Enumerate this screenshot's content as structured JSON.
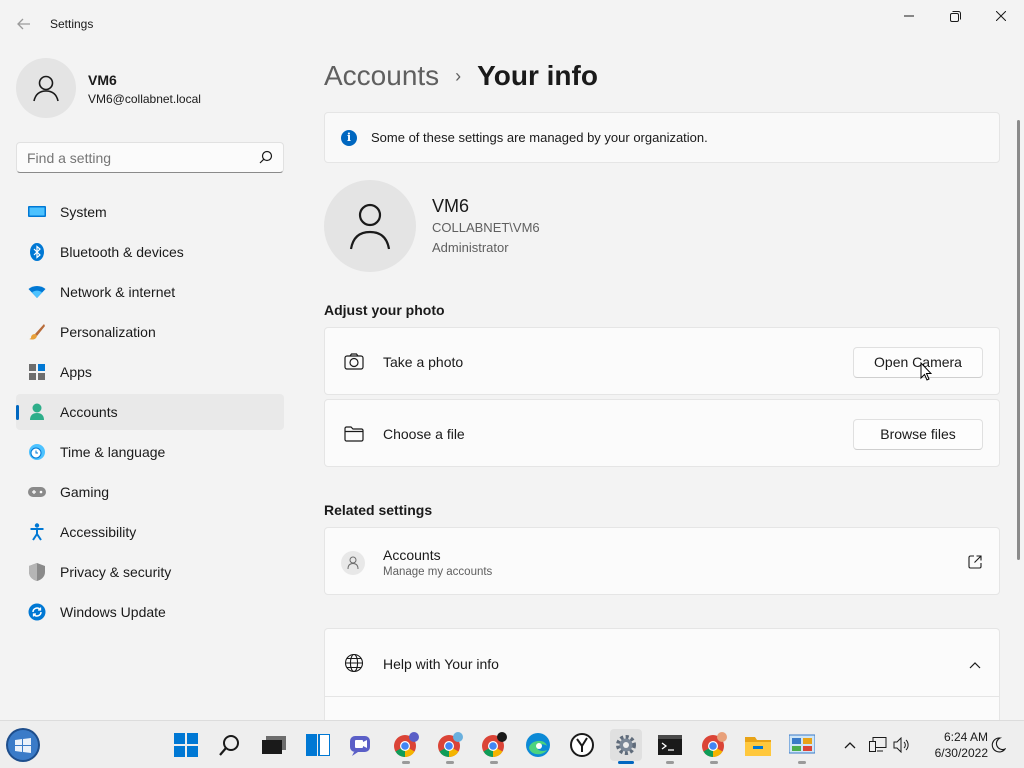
{
  "window": {
    "title": "Settings",
    "back_icon": "back-arrow-icon",
    "controls": [
      "minimize",
      "maximize",
      "close"
    ]
  },
  "profile": {
    "name": "VM6",
    "email": "VM6@collabnet.local"
  },
  "search": {
    "placeholder": "Find a setting",
    "value": ""
  },
  "sidebar": {
    "items": [
      {
        "label": "System",
        "icon": "system-icon"
      },
      {
        "label": "Bluetooth & devices",
        "icon": "bluetooth-icon"
      },
      {
        "label": "Network & internet",
        "icon": "wifi-icon"
      },
      {
        "label": "Personalization",
        "icon": "brush-icon"
      },
      {
        "label": "Apps",
        "icon": "apps-icon"
      },
      {
        "label": "Accounts",
        "icon": "accounts-icon",
        "active": true
      },
      {
        "label": "Time & language",
        "icon": "clock-globe-icon"
      },
      {
        "label": "Gaming",
        "icon": "gamepad-icon"
      },
      {
        "label": "Accessibility",
        "icon": "accessibility-icon"
      },
      {
        "label": "Privacy & security",
        "icon": "shield-icon"
      },
      {
        "label": "Windows Update",
        "icon": "update-icon"
      }
    ]
  },
  "breadcrumb": {
    "parent": "Accounts",
    "separator": "›",
    "current": "Your info"
  },
  "notice": {
    "text": "Some of these settings are managed by your organization."
  },
  "user": {
    "name": "VM6",
    "domain_account": "COLLABNET\\VM6",
    "role": "Administrator"
  },
  "adjust_photo": {
    "title": "Adjust your photo",
    "take_photo": {
      "label": "Take a photo",
      "button": "Open Camera"
    },
    "choose_file": {
      "label": "Choose a file",
      "button": "Browse files"
    }
  },
  "related": {
    "title": "Related settings",
    "accounts": {
      "label": "Accounts",
      "sub": "Manage my accounts"
    }
  },
  "help": {
    "label": "Help with Your info"
  },
  "taskbar": {
    "pinned": [
      "start",
      "search",
      "task-view",
      "widgets",
      "teams-chat",
      "chrome",
      "chrome-profile",
      "chrome-user",
      "edge",
      "clock-app",
      "settings",
      "terminal",
      "chrome-alt",
      "file-explorer",
      "control-panel"
    ],
    "clock_time": "6:24 AM",
    "clock_date": "6/30/2022"
  },
  "colors": {
    "accent": "#0067c0",
    "background": "#f3f3f3",
    "card": "#fbfbfb"
  }
}
